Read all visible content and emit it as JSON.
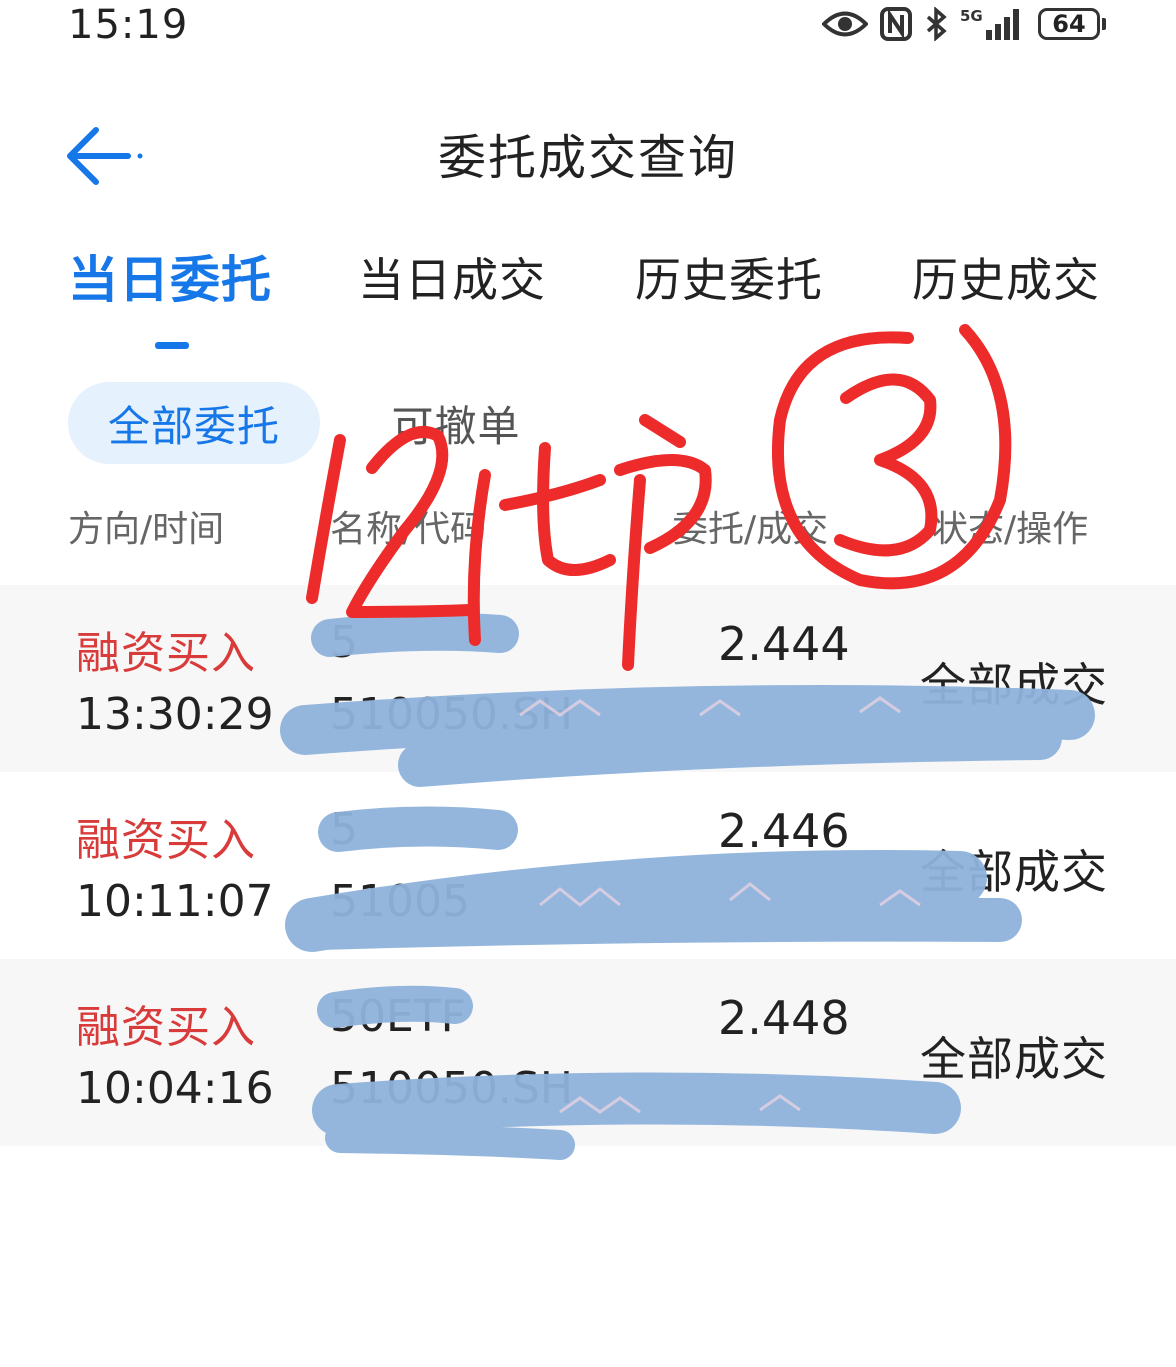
{
  "status_bar": {
    "time": "15:19",
    "icons": [
      "eye-icon",
      "nfc-icon",
      "bluetooth-icon",
      "5g-signal-icon",
      "battery-icon"
    ],
    "network_label": "5G",
    "battery_level": "64"
  },
  "header": {
    "title": "委托成交查询"
  },
  "tabs": [
    {
      "label": "当日委托",
      "active": true
    },
    {
      "label": "当日成交",
      "active": false
    },
    {
      "label": "历史委托",
      "active": false
    },
    {
      "label": "历史成交",
      "active": false
    }
  ],
  "filters": [
    {
      "label": "全部委托",
      "active": true
    },
    {
      "label": "可撤单",
      "active": false
    }
  ],
  "columns": [
    "方向/时间",
    "名称/代码",
    "委托/成交",
    "状态/操作"
  ],
  "orders": [
    {
      "direction": "融资买入",
      "time": "13:30:29",
      "name": "5",
      "code": "510050.SH",
      "price": "2.444",
      "status": "全部成交"
    },
    {
      "direction": "融资买入",
      "time": "10:11:07",
      "name": "5",
      "code": "51005",
      "price": "2.446",
      "status": "全部成交"
    },
    {
      "direction": "融资买入",
      "time": "10:04:16",
      "name": "50ETF",
      "code": "510050.SH",
      "price": "2.448",
      "status": "全部成交"
    }
  ],
  "annotation": {
    "handwritten_text": "12t户③"
  },
  "colors": {
    "accent": "#1677e8",
    "buy": "#d93a3a",
    "chip_bg": "#e5f1fc",
    "redaction": "#8fb3dc",
    "ink": "#ee2b2b"
  }
}
